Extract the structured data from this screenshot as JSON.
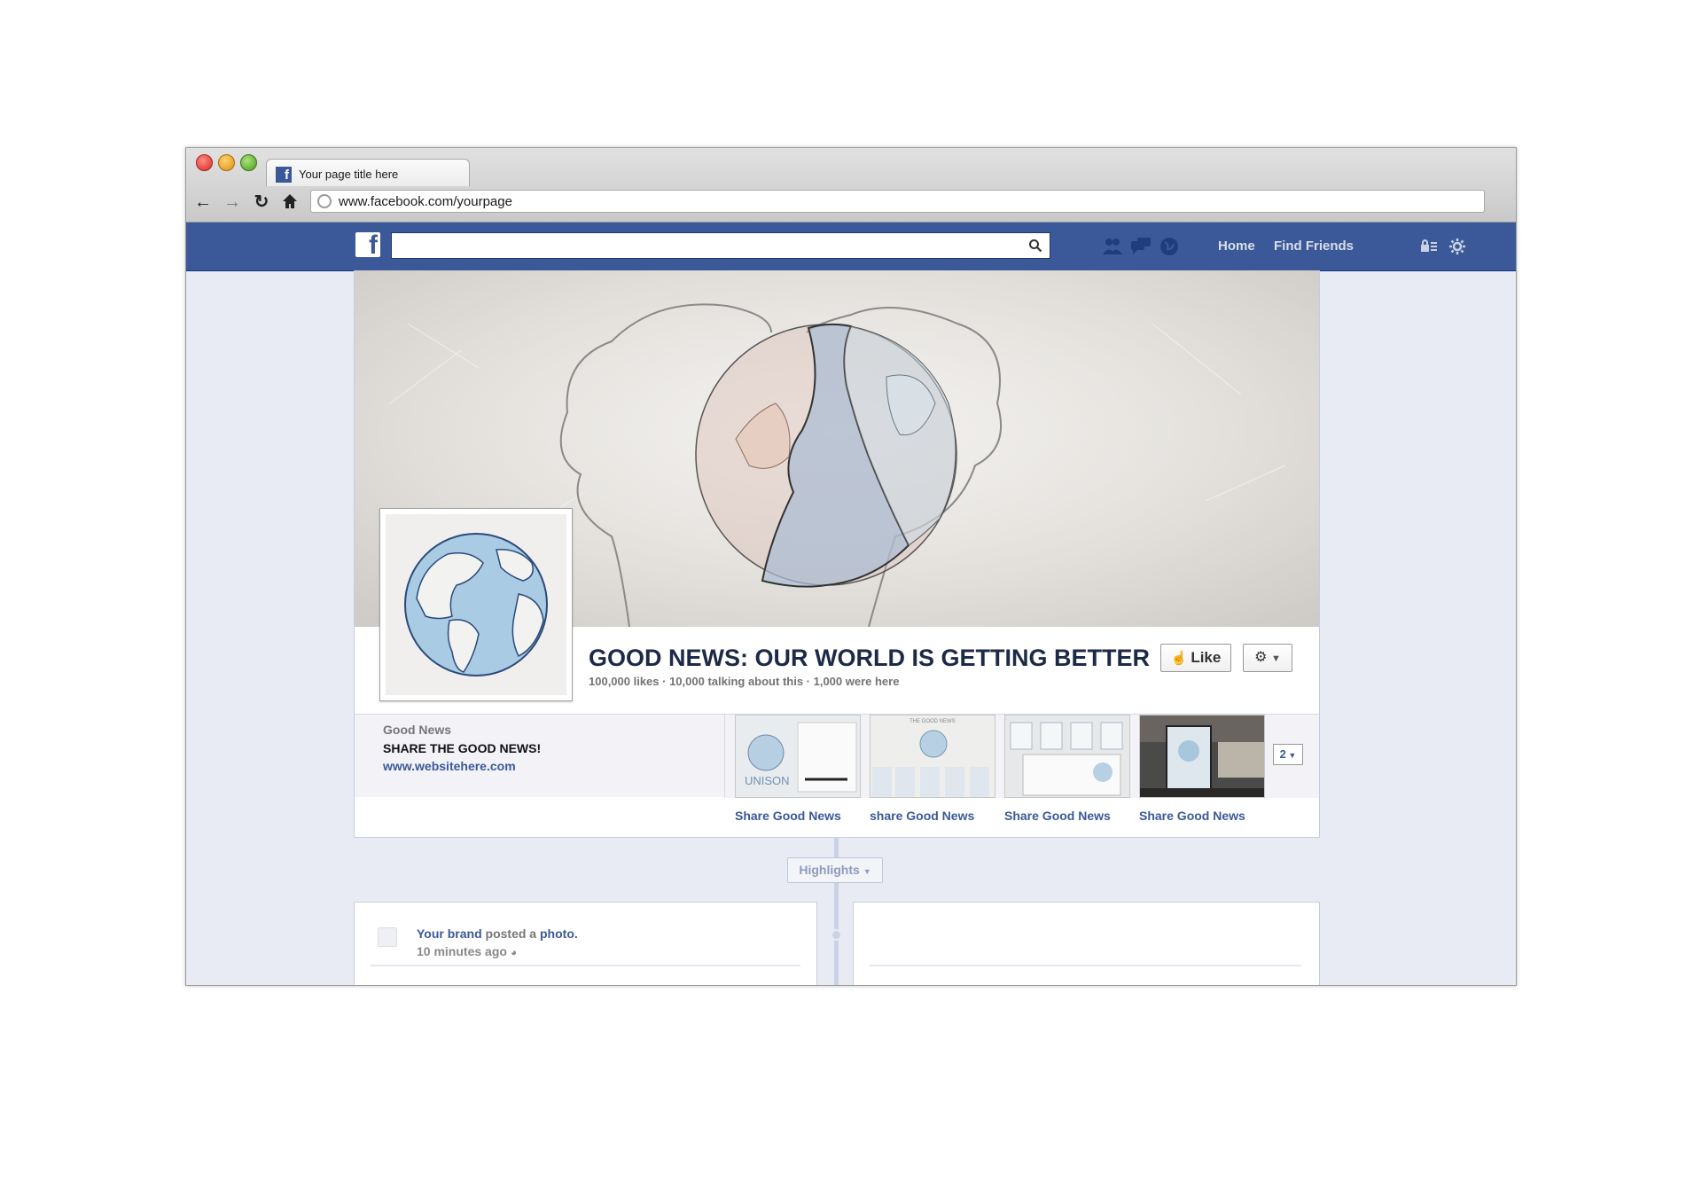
{
  "browser": {
    "tab_title": "Your page title here",
    "url": "www.facebook.com/yourpage"
  },
  "fb_nav": {
    "home": "Home",
    "find_friends": "Find Friends"
  },
  "page": {
    "title": "GOOD NEWS: OUR WORLD IS GETTING BETTER",
    "stats": "100,000 likes · 10,000 talking about this · 1,000 were here",
    "like_label": "Like",
    "about": {
      "name": "Good News",
      "description": "SHARE THE GOOD NEWS!",
      "url": "www.websitehere.com"
    },
    "apps": [
      {
        "label": "Share Good News",
        "thumb_text": "UNISON"
      },
      {
        "label": "share Good News",
        "thumb_text": "THE GOOD NEWS"
      },
      {
        "label": "Share Good News",
        "thumb_text": ""
      },
      {
        "label": "Share Good News",
        "thumb_text": ""
      }
    ],
    "more_count": "2"
  },
  "timeline": {
    "highlights_label": "Highlights",
    "post": {
      "author": "Your brand",
      "action": "posted a",
      "object": "photo.",
      "time": "10 minutes ago"
    }
  },
  "colors": {
    "fb_blue": "#3b5998",
    "page_bg": "#e9ebf4",
    "link": "#3b5998"
  }
}
